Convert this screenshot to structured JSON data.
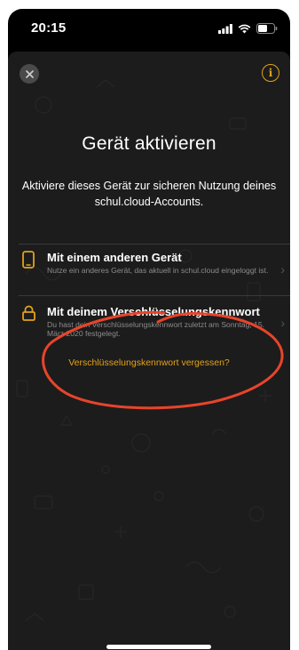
{
  "status_bar": {
    "time": "20:15",
    "icons": [
      "signal-icon",
      "wifi-icon",
      "battery-icon"
    ]
  },
  "header": {
    "close_icon": "close-icon",
    "info_icon": "info-icon",
    "info_glyph": "i"
  },
  "main": {
    "title": "Gerät aktivieren",
    "subtitle_line1": "Aktiviere dieses Gerät zur sicheren Nutzung deines",
    "subtitle_line2": "schul.cloud-Accounts."
  },
  "options": [
    {
      "icon": "phone-icon",
      "title": "Mit einem anderen Gerät",
      "description": "Nutze ein anderes Gerät, das aktuell in schul.cloud eingeloggt ist."
    },
    {
      "icon": "lock-icon",
      "title": "Mit deinem Verschlüsselungskennwort",
      "description": "Du hast dein Verschlüsselungskennwort zuletzt am Sonntag, 15. März 2020 festgelegt."
    }
  ],
  "forgot_link": "Verschlüsselungskennwort vergessen?",
  "colors": {
    "accent": "#e3a21a",
    "background": "#1c1c1c",
    "annotation": "#e8442a"
  }
}
